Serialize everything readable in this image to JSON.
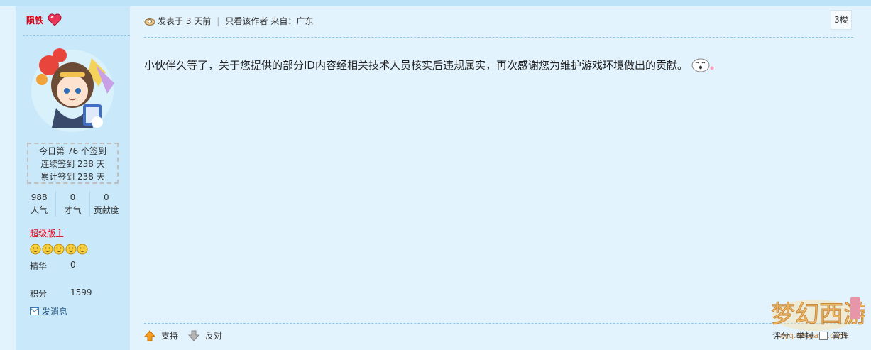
{
  "author": {
    "name": "陨铁"
  },
  "checkin": {
    "line1": "今日第 76 个签到",
    "line2": "连续签到 238 天",
    "line3": "累计签到 238 天"
  },
  "stats": [
    {
      "value": "988",
      "label": "人气"
    },
    {
      "value": "0",
      "label": "才气"
    },
    {
      "value": "0",
      "label": "贡献度"
    }
  ],
  "rank": "超级版主",
  "jinghua": {
    "label": "精华",
    "value": "0"
  },
  "jifen": {
    "label": "积分",
    "value": "1599"
  },
  "send_message": "发消息",
  "post": {
    "posted": "发表于 3 天前",
    "only_author": "只看该作者",
    "from": "来自：广东",
    "floor": "3楼",
    "content": "小伙伴久等了，关于您提供的部分ID内容经相关技术人员核实后违规属实，再次感谢您为维护游戏环境做出的贡献。"
  },
  "actions": {
    "support": "支持",
    "oppose": "反对"
  },
  "right_actions": {
    "rate": "评分",
    "report": "举报",
    "manage": "管理"
  },
  "icons": [
    "heart-icon",
    "clock-icon",
    "mail-icon",
    "thumb-up-icon",
    "thumb-down-icon",
    "smiley-icon",
    "emoticon-icon"
  ],
  "colors": {
    "accent_red": "#e60012",
    "sidebar_bg": "#c9e9fb",
    "main_bg": "#e3f3fd",
    "link": "#2a5a87"
  }
}
